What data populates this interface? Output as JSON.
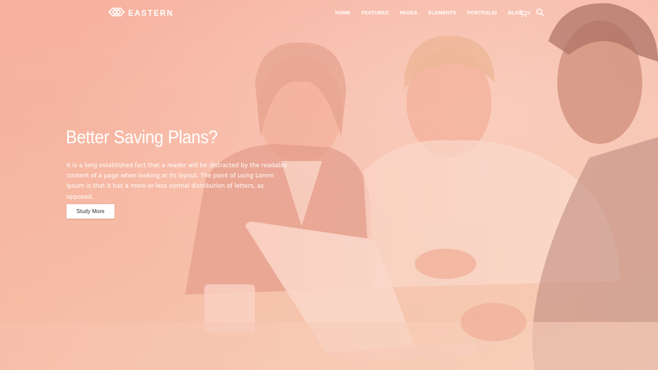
{
  "brand": {
    "name": "EASTERN",
    "logo_icon": "diamond-chain-logo"
  },
  "nav": {
    "items": [
      "HOME",
      "FEATURES",
      "PAGES",
      "ELEMENTS",
      "PORTFOLIO",
      "BLOG"
    ],
    "cart_count": "2",
    "cart_icon": "cart-icon",
    "search_icon": "search-icon"
  },
  "hero": {
    "title": "Better Saving Plans?",
    "description": "It is a long established fact that a reader will be distracted by the readable content of a page when looking at its layout. The point of using Lorem Ipsum is that it has a more-or-less normal distribution of letters, as opposed.",
    "cta_label": "Study More"
  },
  "colors": {
    "overlay": "#f6c3b0",
    "text": "#ffffff",
    "button_bg": "#ffffff",
    "button_text": "#333333"
  }
}
